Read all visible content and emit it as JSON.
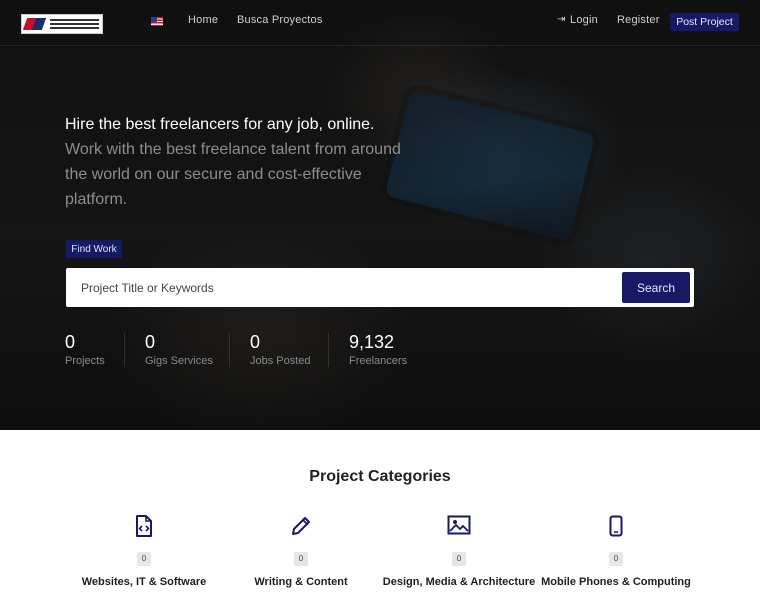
{
  "nav": {
    "logo_alt": "Cámara U.S.-México Chamber of International Construction",
    "flag": "us-flag-icon",
    "home": "Home",
    "busca": "Busca Proyectos",
    "login": "Login",
    "register": "Register",
    "post_project": "Post Project"
  },
  "hero": {
    "headline": "Hire the best freelancers for any job, online.",
    "subline": "Work with the best freelance talent from around the world on our secure and cost-effective platform.",
    "find_work": "Find Work",
    "search": {
      "placeholder": "Project Title or Keywords",
      "button": "Search"
    },
    "stats": [
      {
        "value": "0",
        "label": "Projects"
      },
      {
        "value": "0",
        "label": "Gigs Services"
      },
      {
        "value": "0",
        "label": "Jobs Posted"
      },
      {
        "value": "9,132",
        "label": "Freelancers"
      }
    ]
  },
  "categories": {
    "title": "Project Categories",
    "items": [
      {
        "name": "Websites, IT & Software",
        "count": "0",
        "icon": "code-file-icon"
      },
      {
        "name": "Writing & Content",
        "count": "0",
        "icon": "pencil-icon"
      },
      {
        "name": "Design, Media & Architecture",
        "count": "0",
        "icon": "image-icon"
      },
      {
        "name": "Mobile Phones & Computing",
        "count": "0",
        "icon": "mobile-phone-icon"
      }
    ]
  },
  "colors": {
    "primary": "#161a66",
    "hero_bg": "#1a1a1a",
    "muted_text": "#8d8d8d"
  }
}
